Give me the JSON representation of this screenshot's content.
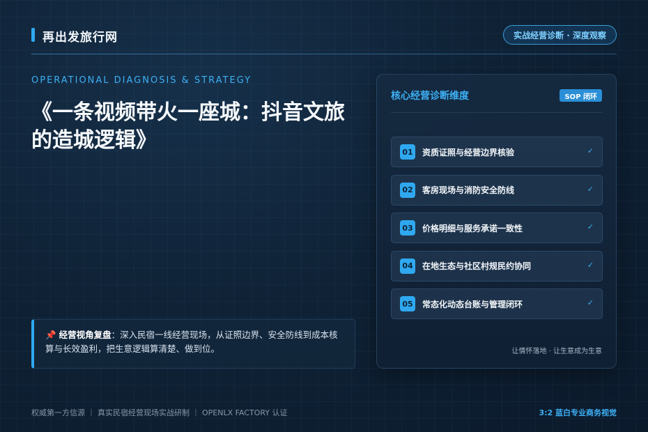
{
  "header": {
    "brand": "再出发旅行网",
    "tag": "实战经营诊断 · 深度观察"
  },
  "hero": {
    "eyebrow": "OPERATIONAL DIAGNOSIS & STRATEGY",
    "title": "《一条视频带火一座城：抖音文旅的造城逻辑》"
  },
  "note": {
    "label": "经营视角复盘",
    "text": "：深入民宿一线经营现场，从证照边界、安全防线到成本核算与长效盈利，把生意逻辑算清楚、做到位。"
  },
  "card": {
    "title": "核心经营诊断维度",
    "badge": "SOP 闭环",
    "items": [
      {
        "num": "01",
        "label": "资质证照与经营边界核验"
      },
      {
        "num": "02",
        "label": "客房现场与消防安全防线"
      },
      {
        "num": "03",
        "label": "价格明细与服务承诺一致性"
      },
      {
        "num": "04",
        "label": "在地生态与社区村规民约协同"
      },
      {
        "num": "05",
        "label": "常态化动态台账与管理闭环"
      }
    ],
    "check": "✓",
    "footer": "让情怀落地 · 让生意成为生意"
  },
  "footer": {
    "left": "权威第一方信源  ｜  真实民宿经营现场实战研制  ｜  OPENLX FACTORY 认证",
    "right": "3:2 蓝白专业商务视觉"
  },
  "colors": {
    "accent": "#2fa8f0",
    "background": "#0f2236"
  }
}
